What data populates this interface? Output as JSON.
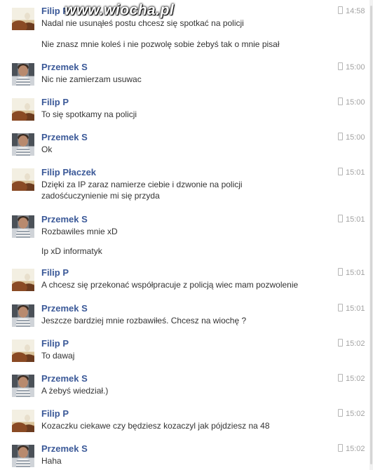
{
  "watermark": "www.wiocha.pl",
  "colors": {
    "sender_name": "#3b5998",
    "message_text": "#333333",
    "timestamp": "#a3a3a3"
  },
  "icons": {
    "timestamp": "phone-icon"
  },
  "messages": [
    {
      "sender": "Filip P",
      "time": "14:58",
      "lines": [
        "Nadal nie usunąłeś postu chcesz się spotkać na policji",
        "Nie znasz mnie koleś i nie pozwolę sobie żebyś tak o mnie pisał"
      ]
    },
    {
      "sender": "Przemek S",
      "time": "15:00",
      "lines": [
        "Nic nie zamierzam usuwac"
      ]
    },
    {
      "sender": "Filip P",
      "time": "15:00",
      "lines": [
        "To się spotkamy na policji"
      ]
    },
    {
      "sender": "Przemek S",
      "time": "15:00",
      "lines": [
        "Ok"
      ]
    },
    {
      "sender": "Filip Płaczek",
      "time": "15:01",
      "lines": [
        "Dzięki za IP zaraz namierze ciebie i dzwonie na policji",
        "zadośćuczynienie mi się przyda"
      ]
    },
    {
      "sender": "Przemek S",
      "time": "15:01",
      "lines": [
        "Rozbawiles mnie xD",
        "Ip xD informatyk"
      ]
    },
    {
      "sender": "Filip P",
      "time": "15:01",
      "lines": [
        "A chcesz się przekonać współpracuje z policją wiec mam pozwolenie"
      ]
    },
    {
      "sender": "Przemek S",
      "time": "15:01",
      "lines": [
        "Jeszcze bardziej mnie rozbawiłeś. Chcesz na wiochę ?"
      ]
    },
    {
      "sender": "Filip P",
      "time": "15:02",
      "lines": [
        "To dawaj"
      ]
    },
    {
      "sender": "Przemek S",
      "time": "15:02",
      "lines": [
        "A żebyś wiedział.)"
      ]
    },
    {
      "sender": "Filip P",
      "time": "15:02",
      "lines": [
        "Kozaczku ciekawe czy będziesz kozaczyl jak pójdziesz na 48"
      ]
    },
    {
      "sender": "Przemek S",
      "time": "15:02",
      "lines": [
        "Haha"
      ]
    }
  ]
}
